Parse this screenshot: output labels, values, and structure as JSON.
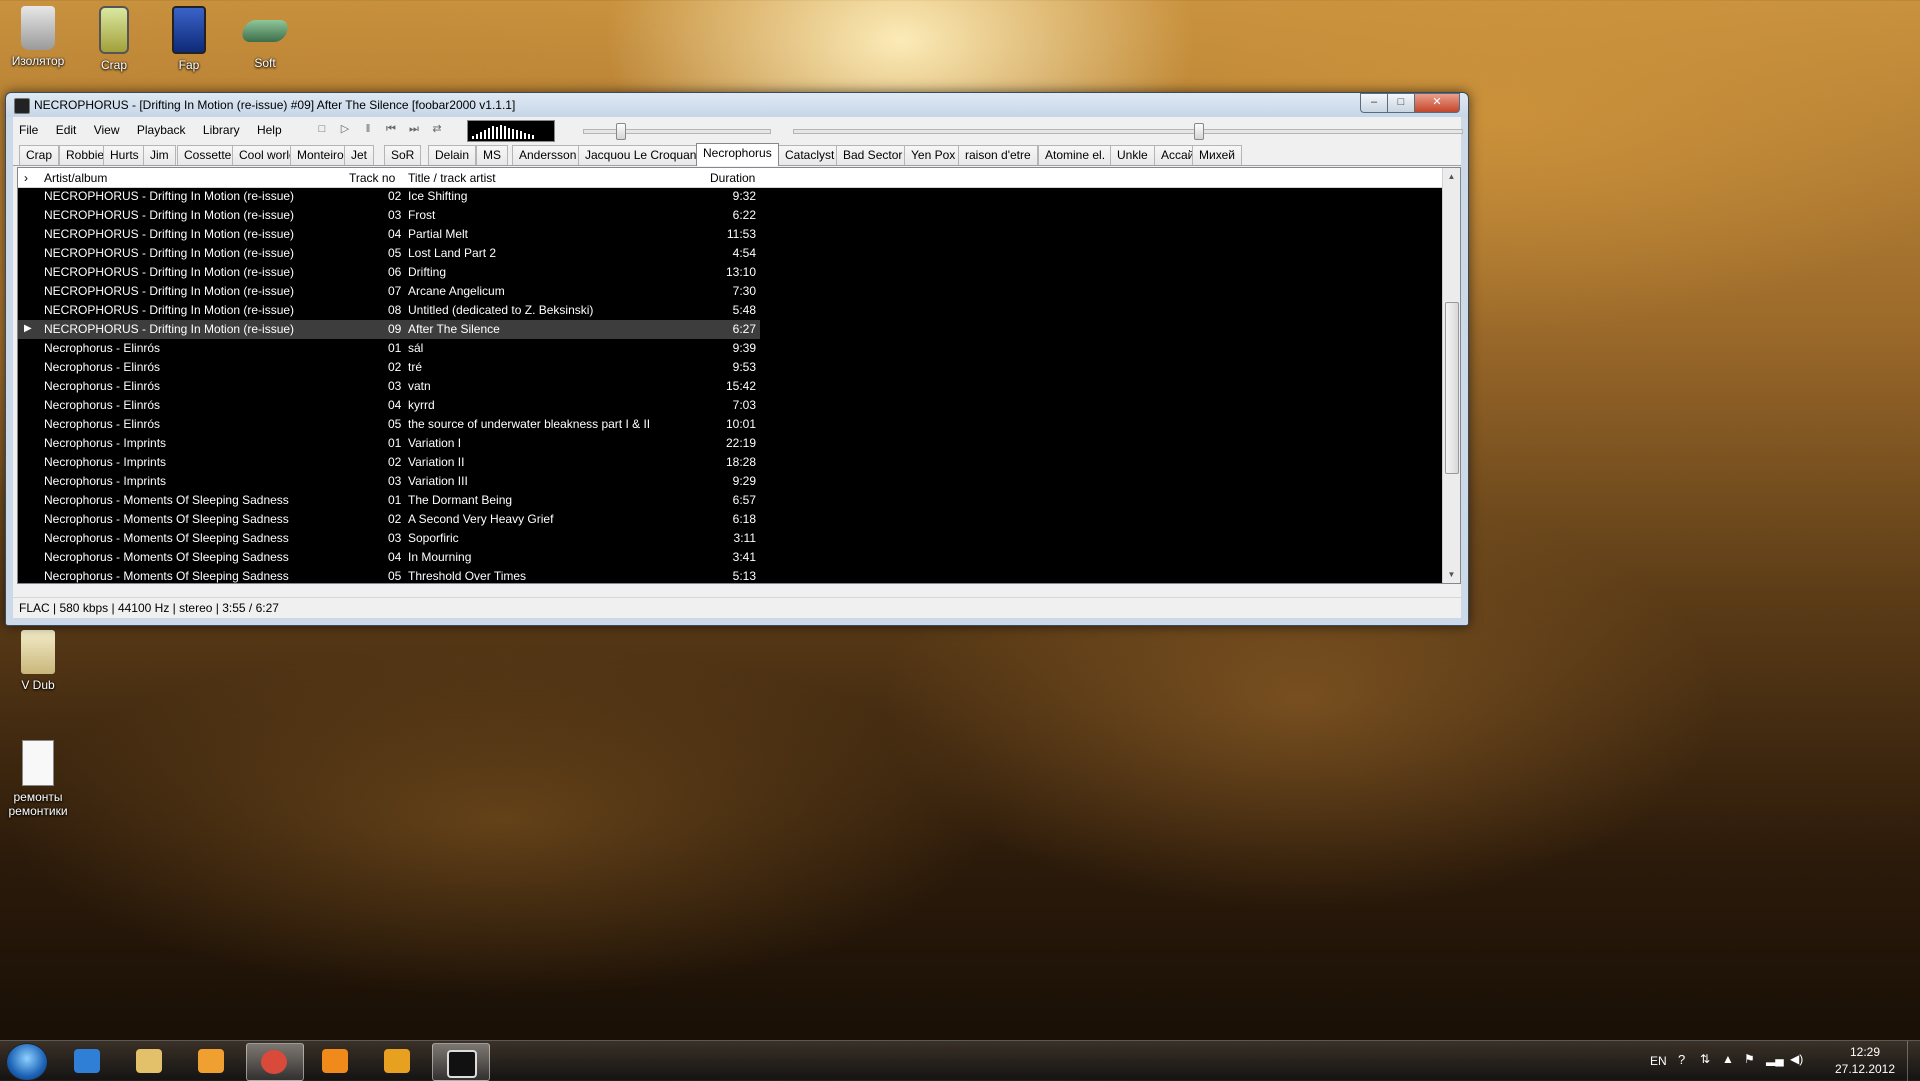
{
  "desktop": {
    "icons": [
      {
        "label": "Изолятор"
      },
      {
        "label": "Crap"
      },
      {
        "label": "Fap"
      },
      {
        "label": "Soft"
      },
      {
        "label": "V Dub"
      },
      {
        "label": "ремонты ремонтики"
      }
    ]
  },
  "window": {
    "title": "NECROPHORUS - [Drifting In Motion (re-issue) #09] After The Silence  [foobar2000 v1.1.1]",
    "minimize_label": "–",
    "maximize_label": "□",
    "close_label": "✕"
  },
  "menu": {
    "file": "File",
    "edit": "Edit",
    "view": "View",
    "playback": "Playback",
    "library": "Library",
    "help": "Help"
  },
  "toolbar": {
    "stop_icon": "□",
    "play_icon": "▷",
    "pause_icon": "‖",
    "prev_icon": "⏮",
    "next_icon": "⏭",
    "random_icon": "⇄",
    "volume_level": 0.18,
    "seek_level": 0.6
  },
  "tabs": [
    {
      "label": "Crap"
    },
    {
      "label": "Robbie"
    },
    {
      "label": "Hurts"
    },
    {
      "label": "Jim"
    },
    {
      "label": "Cossette"
    },
    {
      "label": "Cool world"
    },
    {
      "label": "Monteiro"
    },
    {
      "label": "Jet"
    },
    {
      "label": "SoR"
    },
    {
      "label": "Delain"
    },
    {
      "label": "MS"
    },
    {
      "label": "Andersson"
    },
    {
      "label": "Jacquou Le Croquant"
    },
    {
      "label": "Necrophorus",
      "active": true
    },
    {
      "label": "Cataclyst"
    },
    {
      "label": "Bad Sector"
    },
    {
      "label": "Yen Pox"
    },
    {
      "label": "raison d'etre"
    },
    {
      "label": "Atomine el."
    },
    {
      "label": "Unkle"
    },
    {
      "label": "Ассай"
    },
    {
      "label": "Михей"
    }
  ],
  "playlist": {
    "sort_indicator": "›",
    "columns": {
      "artist_album": "Artist/album",
      "track_no": "Track no",
      "title": "Title / track artist",
      "duration": "Duration"
    },
    "playing_marker": "▶",
    "rows": [
      {
        "artist": "NECROPHORUS - Drifting In Motion (re-issue)",
        "no": "02",
        "title": "Ice Shifting",
        "dur": "9:32"
      },
      {
        "artist": "NECROPHORUS - Drifting In Motion (re-issue)",
        "no": "03",
        "title": "Frost",
        "dur": "6:22"
      },
      {
        "artist": "NECROPHORUS - Drifting In Motion (re-issue)",
        "no": "04",
        "title": "Partial Melt",
        "dur": "11:53"
      },
      {
        "artist": "NECROPHORUS - Drifting In Motion (re-issue)",
        "no": "05",
        "title": "Lost Land Part 2",
        "dur": "4:54"
      },
      {
        "artist": "NECROPHORUS - Drifting In Motion (re-issue)",
        "no": "06",
        "title": "Drifting",
        "dur": "13:10"
      },
      {
        "artist": "NECROPHORUS - Drifting In Motion (re-issue)",
        "no": "07",
        "title": "Arcane Angelicum",
        "dur": "7:30"
      },
      {
        "artist": "NECROPHORUS - Drifting In Motion (re-issue)",
        "no": "08",
        "title": "Untitled (dedicated to Z. Beksinski)",
        "dur": "5:48"
      },
      {
        "artist": "NECROPHORUS - Drifting In Motion (re-issue)",
        "no": "09",
        "title": "After The Silence",
        "dur": "6:27",
        "playing": true
      },
      {
        "artist": "Necrophorus - Elinrós",
        "no": "01",
        "title": "sál",
        "dur": "9:39"
      },
      {
        "artist": "Necrophorus - Elinrós",
        "no": "02",
        "title": "tré",
        "dur": "9:53"
      },
      {
        "artist": "Necrophorus - Elinrós",
        "no": "03",
        "title": "vatn",
        "dur": "15:42"
      },
      {
        "artist": "Necrophorus - Elinrós",
        "no": "04",
        "title": "kyrrd",
        "dur": "7:03"
      },
      {
        "artist": "Necrophorus - Elinrós",
        "no": "05",
        "title": "the source of underwater bleakness part I & II",
        "dur": "10:01"
      },
      {
        "artist": "Necrophorus - Imprints",
        "no": "01",
        "title": "Variation I",
        "dur": "22:19"
      },
      {
        "artist": "Necrophorus - Imprints",
        "no": "02",
        "title": "Variation II",
        "dur": "18:28"
      },
      {
        "artist": "Necrophorus - Imprints",
        "no": "03",
        "title": "Variation III",
        "dur": "9:29"
      },
      {
        "artist": "Necrophorus - Moments Of Sleeping Sadness",
        "no": "01",
        "title": "The Dormant Being",
        "dur": "6:57"
      },
      {
        "artist": "Necrophorus - Moments Of Sleeping Sadness",
        "no": "02",
        "title": "A Second Very Heavy Grief",
        "dur": "6:18"
      },
      {
        "artist": "Necrophorus - Moments Of Sleeping Sadness",
        "no": "03",
        "title": "Soporfiric",
        "dur": "3:11"
      },
      {
        "artist": "Necrophorus - Moments Of Sleeping Sadness",
        "no": "04",
        "title": "In Mourning",
        "dur": "3:41"
      },
      {
        "artist": "Necrophorus - Moments Of Sleeping Sadness",
        "no": "05",
        "title": "Threshold Over Times",
        "dur": "5:13"
      }
    ]
  },
  "status": {
    "text": "FLAC | 580 kbps | 44100 Hz | stereo | 3:55 / 6:27"
  },
  "taskbar": {
    "apps": [
      {
        "name": "internet-explorer-icon"
      },
      {
        "name": "explorer-icon"
      },
      {
        "name": "media-player-icon"
      },
      {
        "name": "chrome-icon",
        "open": true
      },
      {
        "name": "aimp-icon"
      },
      {
        "name": "dlink-icon"
      },
      {
        "name": "foobar2000-icon",
        "open": true
      }
    ],
    "lang": "EN",
    "time": "12:29",
    "date": "27.12.2012"
  }
}
